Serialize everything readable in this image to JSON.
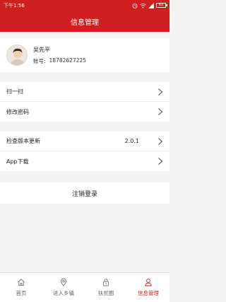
{
  "status_bar": {
    "time": "下午1:56",
    "battery_level": "63"
  },
  "header": {
    "title": "信息管理"
  },
  "profile": {
    "name": "吴先平",
    "account_label": "账号:",
    "account_number": "18782627225"
  },
  "menu": {
    "group1": [
      {
        "label": "扫一扫"
      },
      {
        "label": "修改密码"
      }
    ],
    "group2": [
      {
        "label": "检查版本更新",
        "value": "2.0.1"
      },
      {
        "label": "App下载"
      }
    ]
  },
  "logout": {
    "label": "注销登录"
  },
  "tabbar": {
    "active_color": "#cf1f1f",
    "tabs": [
      {
        "label": "首页",
        "icon": "home-icon"
      },
      {
        "label": "进入乡镇",
        "icon": "location-pin-icon"
      },
      {
        "label": "扶贫圈",
        "icon": "lock-icon"
      },
      {
        "label": "信息管理",
        "icon": "user-icon"
      }
    ]
  }
}
